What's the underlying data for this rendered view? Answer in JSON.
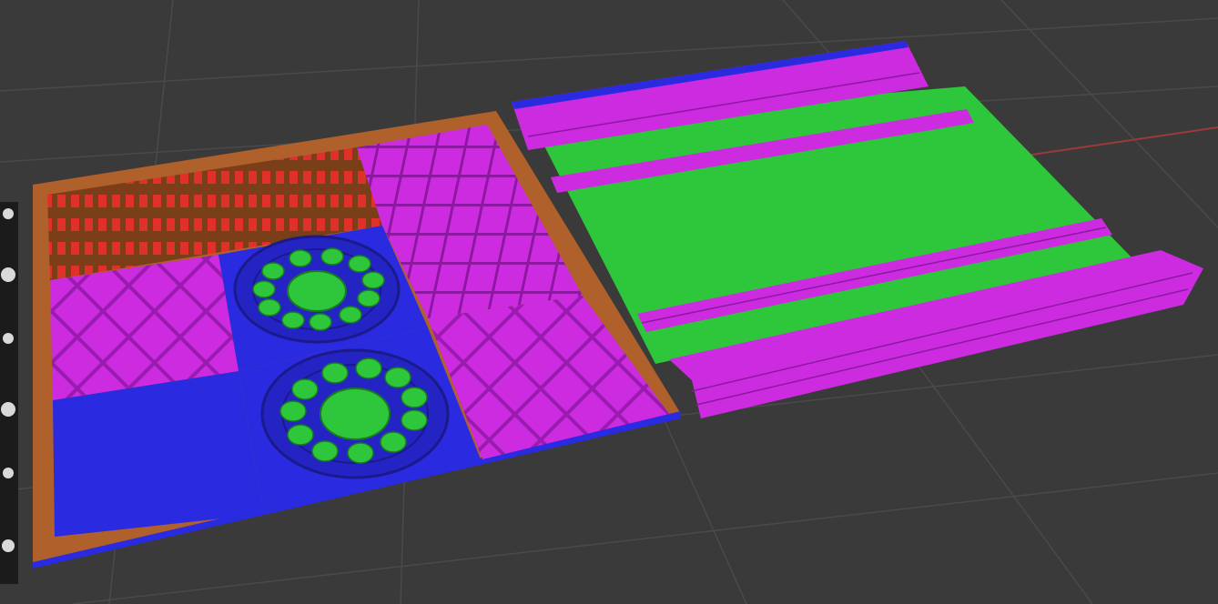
{
  "scene": {
    "background_color": "#3a3a3a",
    "grid_color": "#4a4a4a",
    "axis_x_color": "#9a3a3a",
    "materials": {
      "frame_wood": "#b0602a",
      "blue": "#2a2ae0",
      "magenta": "#cc2be0",
      "green": "#2ec63a",
      "red_brick": "#e0302a"
    },
    "objects": [
      {
        "name": "tile-board",
        "description_icon": "tiled-floor-mesh"
      },
      {
        "name": "road-strip",
        "description_icon": "road-mesh"
      }
    ],
    "side_panel": {
      "pattern_icon": "floral-pattern"
    }
  }
}
